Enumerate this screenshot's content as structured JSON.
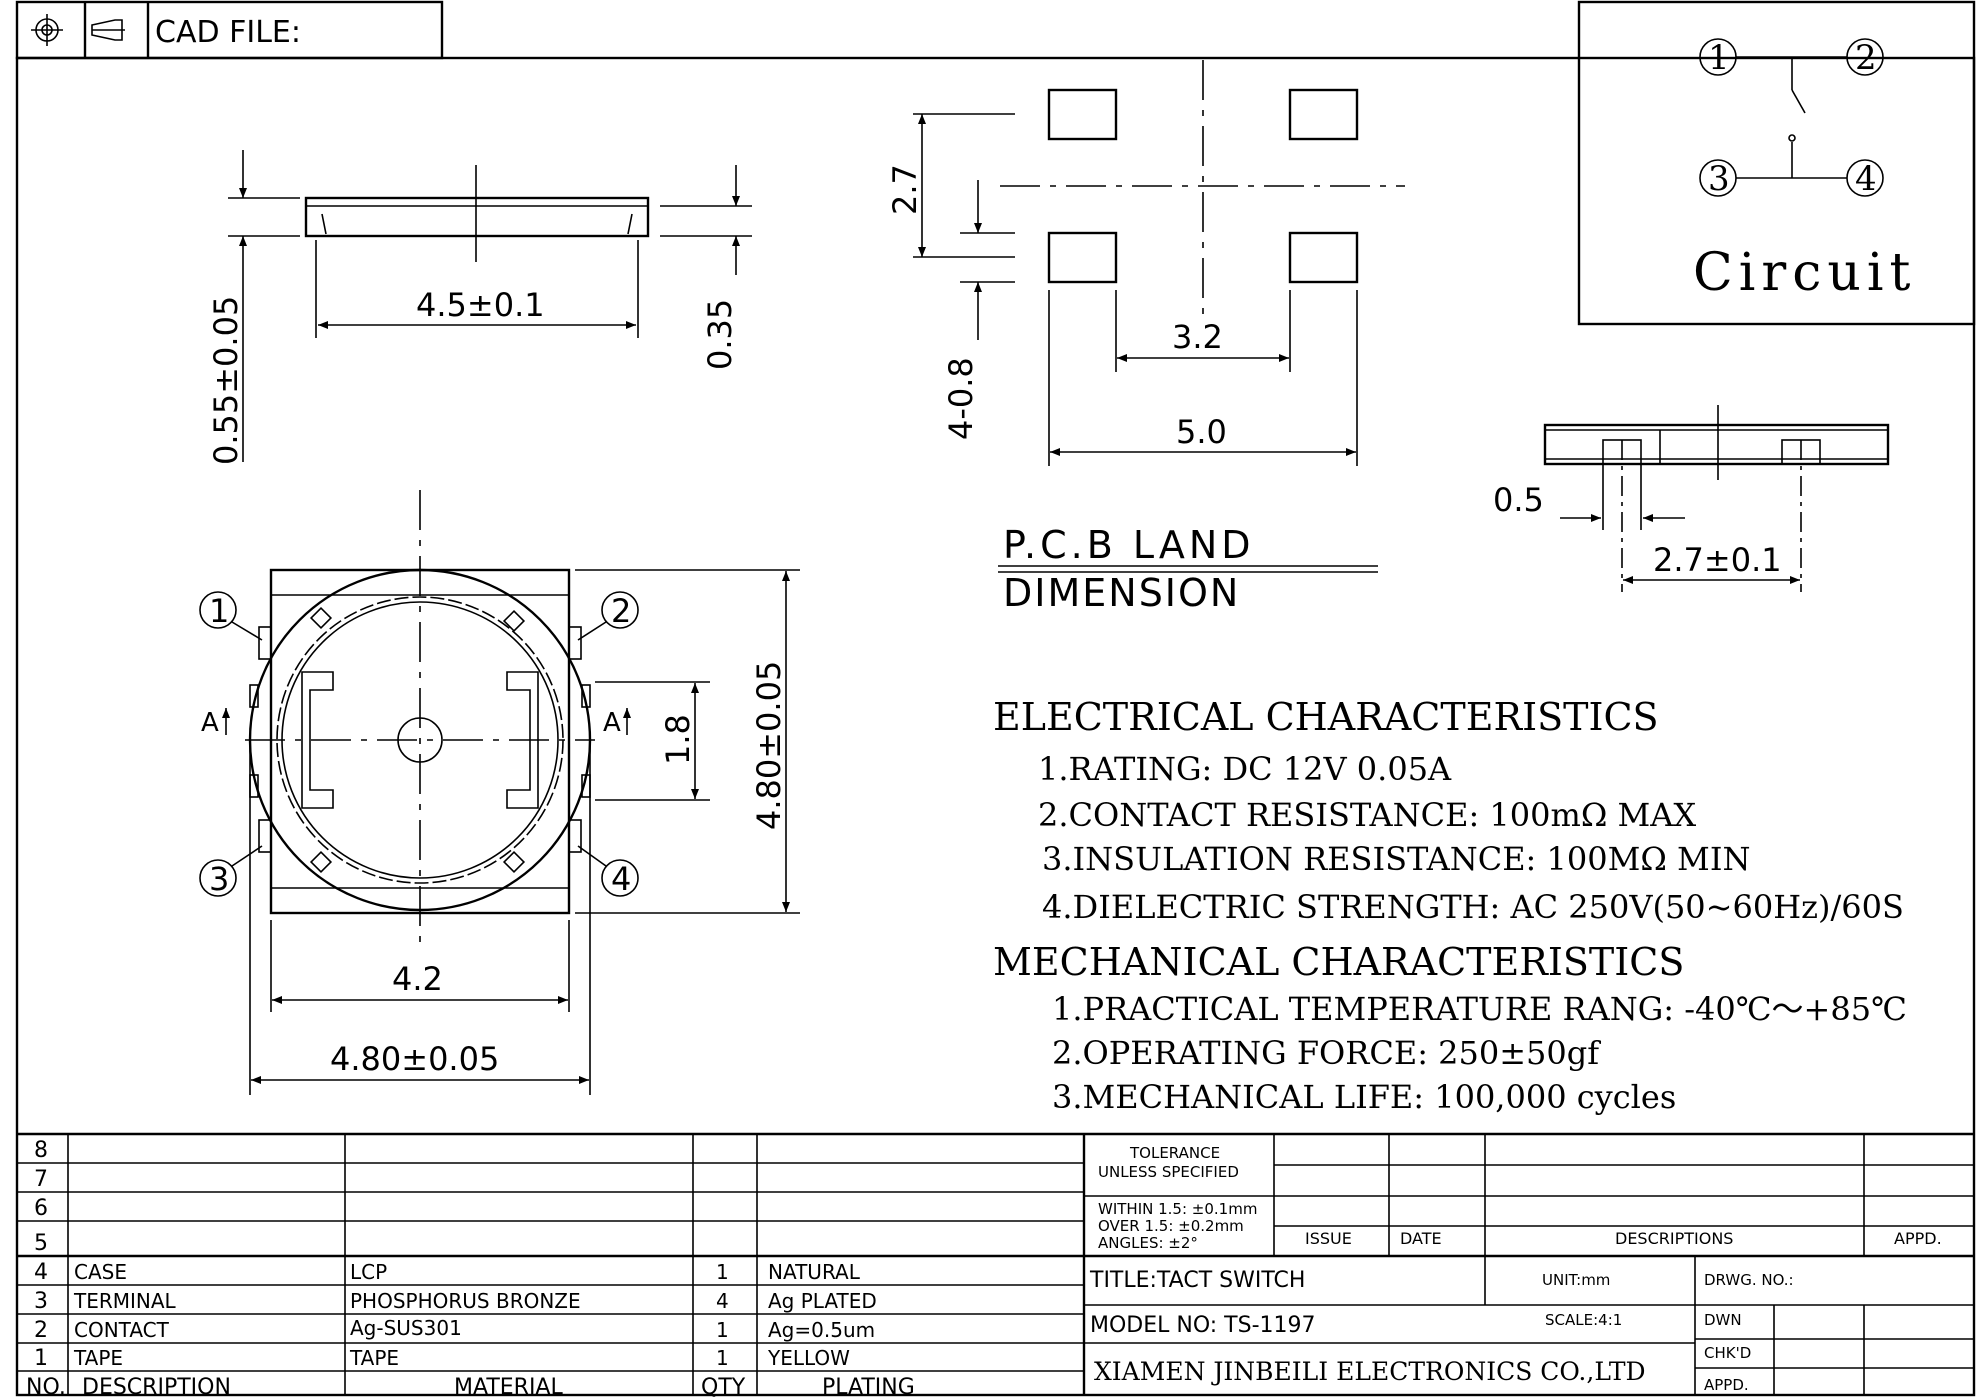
{
  "header": {
    "cad_label": "CAD FILE:"
  },
  "circuit": {
    "title": "Circuit",
    "pins": [
      "1",
      "2",
      "3",
      "4"
    ]
  },
  "side_view": {
    "dim_width": "4.5±0.1",
    "dim_height": "0.55±0.05",
    "dim_thickness": "0.35"
  },
  "pcb_land": {
    "title_line1": "P.C.B LAND",
    "title_line2": "DIMENSION",
    "dim_pitch_v": "2.7",
    "dim_pad_h": "4-0.8",
    "dim_inner": "3.2",
    "dim_outer": "5.0"
  },
  "section_view": {
    "dim_pad": "0.5",
    "dim_pitch": "2.7±0.1"
  },
  "top_view": {
    "pins": [
      "1",
      "2",
      "3",
      "4"
    ],
    "section_mark": "A",
    "dim_inner_h": "1.8",
    "dim_height": "4.80±0.05",
    "dim_inner_w": "4.2",
    "dim_width": "4.80±0.05"
  },
  "specs": {
    "electrical_title": "ELECTRICAL CHARACTERISTICS",
    "electrical": [
      "1.RATING: DC 12V 0.05A",
      "2.CONTACT RESISTANCE: 100mΩ MAX",
      "3.INSULATION RESISTANCE: 100MΩ MIN",
      "4.DIELECTRIC STRENGTH: AC 250V(50~60Hz)/60S"
    ],
    "mechanical_title": "MECHANICAL CHARACTERISTICS",
    "mechanical": [
      "1.PRACTICAL TEMPERATURE RANG: -40℃～+85℃",
      "2.OPERATING FORCE: 250±50gf",
      "3.MECHANICAL LIFE: 100,000 cycles"
    ]
  },
  "bom": {
    "rows": [
      {
        "no": "8",
        "desc": "",
        "material": "",
        "qty": "",
        "plating": ""
      },
      {
        "no": "7",
        "desc": "",
        "material": "",
        "qty": "",
        "plating": ""
      },
      {
        "no": "6",
        "desc": "",
        "material": "",
        "qty": "",
        "plating": ""
      },
      {
        "no": "5",
        "desc": "",
        "material": "",
        "qty": "",
        "plating": ""
      },
      {
        "no": "4",
        "desc": "CASE",
        "material": "LCP",
        "qty": "1",
        "plating": "NATURAL"
      },
      {
        "no": "3",
        "desc": "TERMINAL",
        "material": "PHOSPHORUS BRONZE",
        "qty": "4",
        "plating": "Ag PLATED"
      },
      {
        "no": "2",
        "desc": "CONTACT",
        "material": "Ag-SUS301",
        "qty": "1",
        "plating": "Ag=0.5um"
      },
      {
        "no": "1",
        "desc": "TAPE",
        "material": "TAPE",
        "qty": "1",
        "plating": "YELLOW"
      }
    ],
    "headers": {
      "no": "NO.",
      "desc": "DESCRIPTION",
      "material": "MATERIAL",
      "qty": "QTY",
      "plating": "PLATING"
    }
  },
  "title_block": {
    "tolerance_1": "TOLERANCE",
    "tolerance_2": "UNLESS SPECIFIED",
    "within": "WITHIN 1.5: ±0.1mm",
    "over": "OVER 1.5: ±0.2mm",
    "angles": "ANGLES: ±2°",
    "issue": "ISSUE",
    "date": "DATE",
    "descriptions": "DESCRIPTIONS",
    "appd": "APPD.",
    "title": "TITLE:TACT SWITCH",
    "unit": "UNIT:mm",
    "drwg_no": "DRWG. NO.:",
    "model": "MODEL NO: TS-1197",
    "scale": "SCALE:4:1",
    "dwn": "DWN",
    "chkd": "CHK'D",
    "appd2": "APPD.",
    "company": "XIAMEN JINBEILI ELECTRONICS CO.,LTD"
  }
}
